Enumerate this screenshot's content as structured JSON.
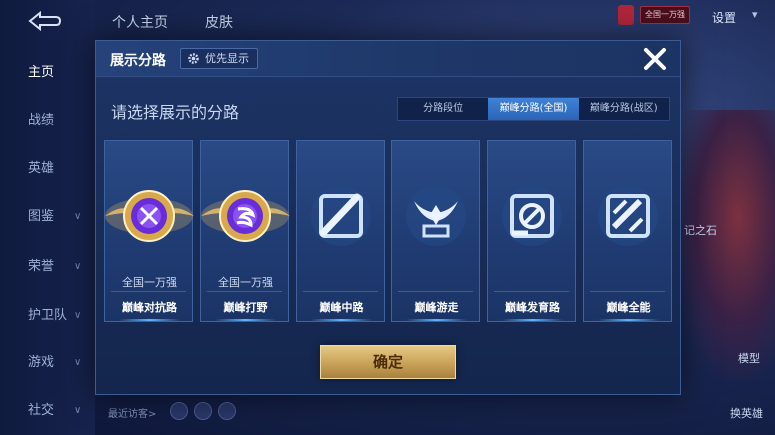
{
  "background": {
    "tabs": [
      "个人主页",
      "皮肤"
    ],
    "settings_label": "设置",
    "badge_text": "全国一万强",
    "sidebar_items": [
      "主页",
      "战绩",
      "英雄",
      "图鉴",
      "荣誉",
      "护卫队",
      "游戏",
      "社交"
    ],
    "right_labels": [
      "记之石",
      "模型",
      "换英雄"
    ],
    "visitors_label": "最近访客>"
  },
  "dialog": {
    "title": "展示分路",
    "priority_label": "优先显示",
    "prompt": "请选择展示的分路",
    "segments": [
      "分路段位",
      "巅峰分路(全国)",
      "巅峰分路(战区)"
    ],
    "active_segment": "巅峰分路(全国)",
    "cards": [
      {
        "label": "巅峰对抗路",
        "rank": "全国一万强",
        "icon": "sword-emblem-icon",
        "highlighted": true
      },
      {
        "label": "巅峰打野",
        "rank": "全国一万强",
        "icon": "claw-emblem-icon",
        "highlighted": true
      },
      {
        "label": "巅峰中路",
        "rank": "",
        "icon": "staff-icon",
        "highlighted": false
      },
      {
        "label": "巅峰游走",
        "rank": "",
        "icon": "wings-icon",
        "highlighted": false
      },
      {
        "label": "巅峰发育路",
        "rank": "",
        "icon": "target-icon",
        "highlighted": false
      },
      {
        "label": "巅峰全能",
        "rank": "",
        "icon": "all-round-icon",
        "highlighted": false
      }
    ],
    "confirm_label": "确定"
  },
  "colors": {
    "accent_blue": "#3f82d6",
    "confirm_gold": "#c9a257",
    "emblem_purple": "#6a2bd8"
  }
}
